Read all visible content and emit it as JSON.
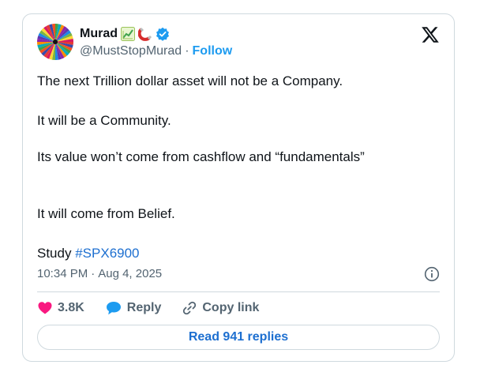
{
  "author": {
    "display_name": "Murad",
    "handle": "@MustStopMurad",
    "separator": "·",
    "follow_label": "Follow",
    "verified": true,
    "badges": [
      "chart-increasing-emoji",
      "magnet-emoji",
      "verified-badge-icon"
    ]
  },
  "tweet": {
    "lines": [
      "The next Trillion dollar asset will not be a Company.",
      "It will be a Community.",
      "Its value won’t come from cashflow and “fundamentals”",
      "It will come from Belief."
    ],
    "study_prefix": "Study",
    "hashtag": "#SPX6900"
  },
  "meta": {
    "time": "10:34 PM",
    "separator": "·",
    "date": "Aug 4, 2025"
  },
  "actions": {
    "likes": "3.8K",
    "reply_label": "Reply",
    "copy_link_label": "Copy link"
  },
  "read_replies_label": "Read 941 replies",
  "colors": {
    "accent": "#1d9bf0",
    "link": "#1d6fd0",
    "like": "#f91880",
    "muted": "#536471",
    "border": "#cfd9de"
  }
}
